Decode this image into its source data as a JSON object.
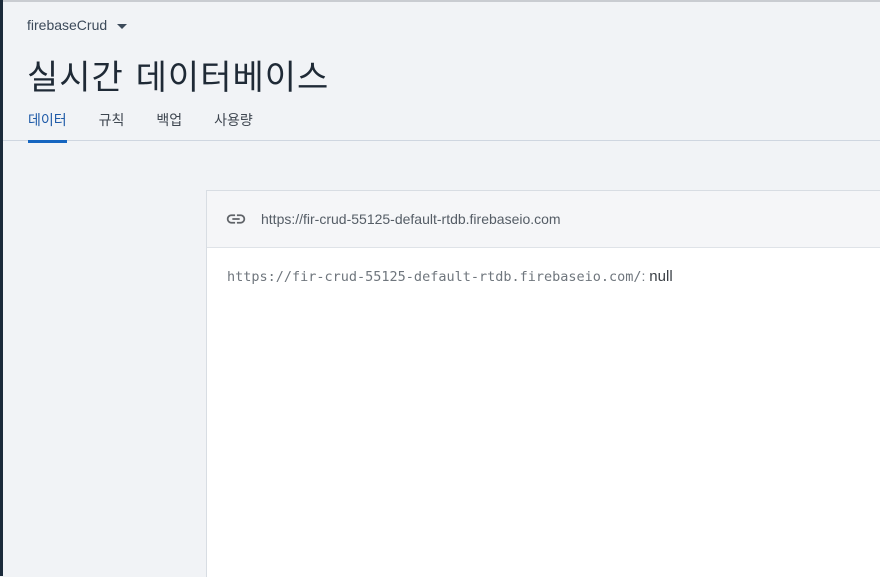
{
  "header": {
    "project_name": "firebaseCrud",
    "title": "실시간 데이터베이스",
    "tabs": [
      {
        "label": "데이터",
        "active": true
      },
      {
        "label": "규칙",
        "active": false
      },
      {
        "label": "백업",
        "active": false
      },
      {
        "label": "사용량",
        "active": false
      }
    ]
  },
  "database": {
    "url": "https://fir-crud-55125-default-rtdb.firebaseio.com",
    "root_key": "https://fir-crud-55125-default-rtdb.firebaseio.com/",
    "separator": ":",
    "root_value": "null"
  },
  "icons": {
    "url_bar": "link-icon",
    "project_dropdown": "chevron-down-icon"
  },
  "colors": {
    "active_tab": "#1e5aa8",
    "background": "#f1f3f6",
    "sidebar": "#1b2a3a"
  }
}
